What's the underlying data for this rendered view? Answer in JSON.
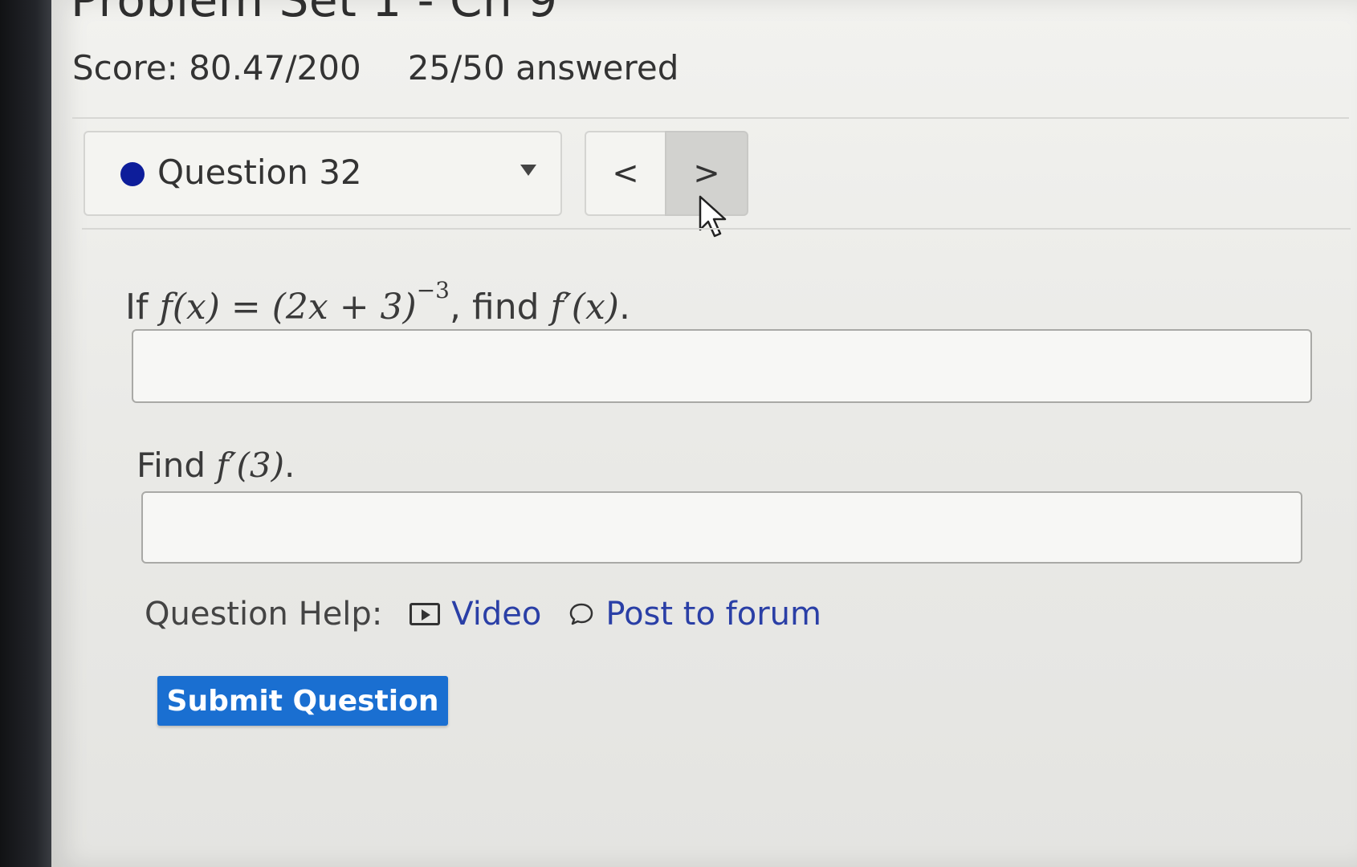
{
  "page": {
    "title_partial": "Problem Set 1 - Ch 9"
  },
  "header": {
    "score": "Score: 80.47/200",
    "answered": "25/50 answered"
  },
  "question_nav": {
    "selected_question": "Question 32",
    "prev_symbol": "<",
    "next_symbol": ">"
  },
  "problem": {
    "lead_word": "If",
    "function_expr": "f(x) = (2x + 3)",
    "exponent": "−3",
    "middle_text": ", find",
    "derivative_expr": "f′(x)",
    "period": ".",
    "find_word": "Find",
    "find_expr": "f′(3)",
    "find_period": "."
  },
  "answers": {
    "answer1_value": "",
    "answer2_value": ""
  },
  "help": {
    "label": "Question Help:",
    "video_label": "Video",
    "forum_label": "Post to forum"
  },
  "actions": {
    "submit_label": "Submit Question",
    "accent_color": "#1a6fd1"
  },
  "icons": {
    "status_dot": "filled-circle-icon",
    "dropdown": "caret-down-icon",
    "video": "video-play-icon",
    "forum": "speech-bubble-icon",
    "cursor": "mouse-pointer-icon"
  }
}
